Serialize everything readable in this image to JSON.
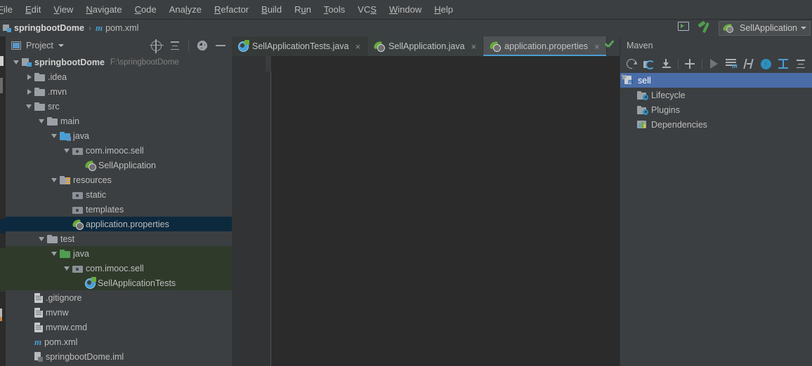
{
  "menu": {
    "items": [
      "File",
      "Edit",
      "View",
      "Navigate",
      "Code",
      "Analyze",
      "Refactor",
      "Build",
      "Run",
      "Tools",
      "VCS",
      "Window",
      "Help"
    ]
  },
  "breadcrumb": {
    "project": "springbootDome",
    "separator": "›",
    "file": "pom.xml",
    "module_icon": "module-icon",
    "maven_icon": "maven-m-icon"
  },
  "toolbar_right": {
    "terminal_icon": "terminal-icon",
    "build_icon": "hammer-build-icon",
    "run_config": "SellApplication",
    "run_config_icon": "spring-boot-icon",
    "dropdown_icon": "chevron-down-icon"
  },
  "project_panel": {
    "title": "Project",
    "view_icon": "project-view-icon",
    "dropdown_icon": "chevron-down-icon",
    "actions": [
      "locate-icon",
      "collapse-all-icon",
      "settings-gear-icon",
      "hide-icon"
    ],
    "tree": [
      {
        "label": "springbootDome",
        "sub": "F:\\springbootDome",
        "depth": 0,
        "arrow": "down",
        "icon": "module-icon",
        "bold": true,
        "state": "normal"
      },
      {
        "label": ".idea",
        "sub": "",
        "depth": 1,
        "arrow": "right",
        "icon": "folder-icon",
        "bold": false,
        "state": "normal"
      },
      {
        "label": ".mvn",
        "sub": "",
        "depth": 1,
        "arrow": "right",
        "icon": "folder-icon",
        "bold": false,
        "state": "normal"
      },
      {
        "label": "src",
        "sub": "",
        "depth": 1,
        "arrow": "down",
        "icon": "folder-icon",
        "bold": false,
        "state": "normal"
      },
      {
        "label": "main",
        "sub": "",
        "depth": 2,
        "arrow": "down",
        "icon": "folder-icon",
        "bold": false,
        "state": "normal"
      },
      {
        "label": "java",
        "sub": "",
        "depth": 3,
        "arrow": "down",
        "icon": "source-folder-icon",
        "bold": false,
        "state": "normal"
      },
      {
        "label": "com.imooc.sell",
        "sub": "",
        "depth": 4,
        "arrow": "down",
        "icon": "package-icon",
        "bold": false,
        "state": "normal"
      },
      {
        "label": "SellApplication",
        "sub": "",
        "depth": 5,
        "arrow": "none",
        "icon": "spring-boot-class-icon",
        "bold": false,
        "state": "normal"
      },
      {
        "label": "resources",
        "sub": "",
        "depth": 3,
        "arrow": "down",
        "icon": "resources-folder-icon",
        "bold": false,
        "state": "normal"
      },
      {
        "label": "static",
        "sub": "",
        "depth": 4,
        "arrow": "none",
        "icon": "package-icon",
        "bold": false,
        "state": "normal"
      },
      {
        "label": "templates",
        "sub": "",
        "depth": 4,
        "arrow": "none",
        "icon": "package-icon",
        "bold": false,
        "state": "normal"
      },
      {
        "label": "application.properties",
        "sub": "",
        "depth": 4,
        "arrow": "none",
        "icon": "spring-properties-icon",
        "bold": false,
        "state": "selected"
      },
      {
        "label": "test",
        "sub": "",
        "depth": 2,
        "arrow": "down",
        "icon": "folder-icon",
        "bold": false,
        "state": "normal"
      },
      {
        "label": "java",
        "sub": "",
        "depth": 3,
        "arrow": "down",
        "icon": "test-source-folder-icon",
        "bold": false,
        "state": "testroot"
      },
      {
        "label": "com.imooc.sell",
        "sub": "",
        "depth": 4,
        "arrow": "down",
        "icon": "package-icon",
        "bold": false,
        "state": "testroot"
      },
      {
        "label": "SellApplicationTests",
        "sub": "",
        "depth": 5,
        "arrow": "none",
        "icon": "test-class-icon",
        "bold": false,
        "state": "testroot"
      },
      {
        "label": ".gitignore",
        "sub": "",
        "depth": 1,
        "arrow": "none",
        "icon": "file-icon",
        "bold": false,
        "state": "normal"
      },
      {
        "label": "mvnw",
        "sub": "",
        "depth": 1,
        "arrow": "none",
        "icon": "file-icon",
        "bold": false,
        "state": "normal"
      },
      {
        "label": "mvnw.cmd",
        "sub": "",
        "depth": 1,
        "arrow": "none",
        "icon": "file-icon",
        "bold": false,
        "state": "normal"
      },
      {
        "label": "pom.xml",
        "sub": "",
        "depth": 1,
        "arrow": "none",
        "icon": "maven-m-icon",
        "bold": false,
        "state": "normal"
      },
      {
        "label": "springbootDome.iml",
        "sub": "",
        "depth": 1,
        "arrow": "none",
        "icon": "iml-file-icon",
        "bold": false,
        "state": "normal"
      }
    ]
  },
  "editor": {
    "tabs": [
      {
        "label": "SellApplicationTests.java",
        "icon": "test-class-icon",
        "active": false,
        "close_icon": "close-icon"
      },
      {
        "label": "SellApplication.java",
        "icon": "spring-boot-class-icon",
        "active": false,
        "close_icon": "close-icon"
      },
      {
        "label": "application.properties",
        "icon": "spring-properties-icon",
        "active": true,
        "close_icon": "close-icon"
      }
    ],
    "content": "",
    "inspection_icon": "inspection-ok-checkmark"
  },
  "maven_panel": {
    "title": "Maven",
    "toolbar": [
      "reimport-icon",
      "generate-sources-icon",
      "download-sources-icon",
      "add-maven-project-icon",
      "run-icon",
      "execute-maven-goal-icon",
      "toggle-skip-tests-icon",
      "toggle-offline-icon",
      "show-dependencies-icon",
      "collapse-all-icon"
    ],
    "tree": [
      {
        "label": "sell",
        "depth": 0,
        "arrow": "down",
        "icon": "maven-module-icon",
        "selected": true
      },
      {
        "label": "Lifecycle",
        "depth": 1,
        "arrow": "right",
        "icon": "phase-folder-icon",
        "selected": false
      },
      {
        "label": "Plugins",
        "depth": 1,
        "arrow": "right",
        "icon": "phase-folder-icon",
        "selected": false
      },
      {
        "label": "Dependencies",
        "depth": 1,
        "arrow": "right",
        "icon": "dependencies-icon",
        "selected": false
      }
    ]
  },
  "colors": {
    "background": "#3c3f41",
    "editor_bg": "#2b2b2b",
    "selection_blue": "#4a6da7",
    "selection_dark": "#0d293e",
    "test_root_green": "#2f3a2b",
    "accent_blue": "#4a9ed4",
    "text": "#bdbdbd"
  }
}
